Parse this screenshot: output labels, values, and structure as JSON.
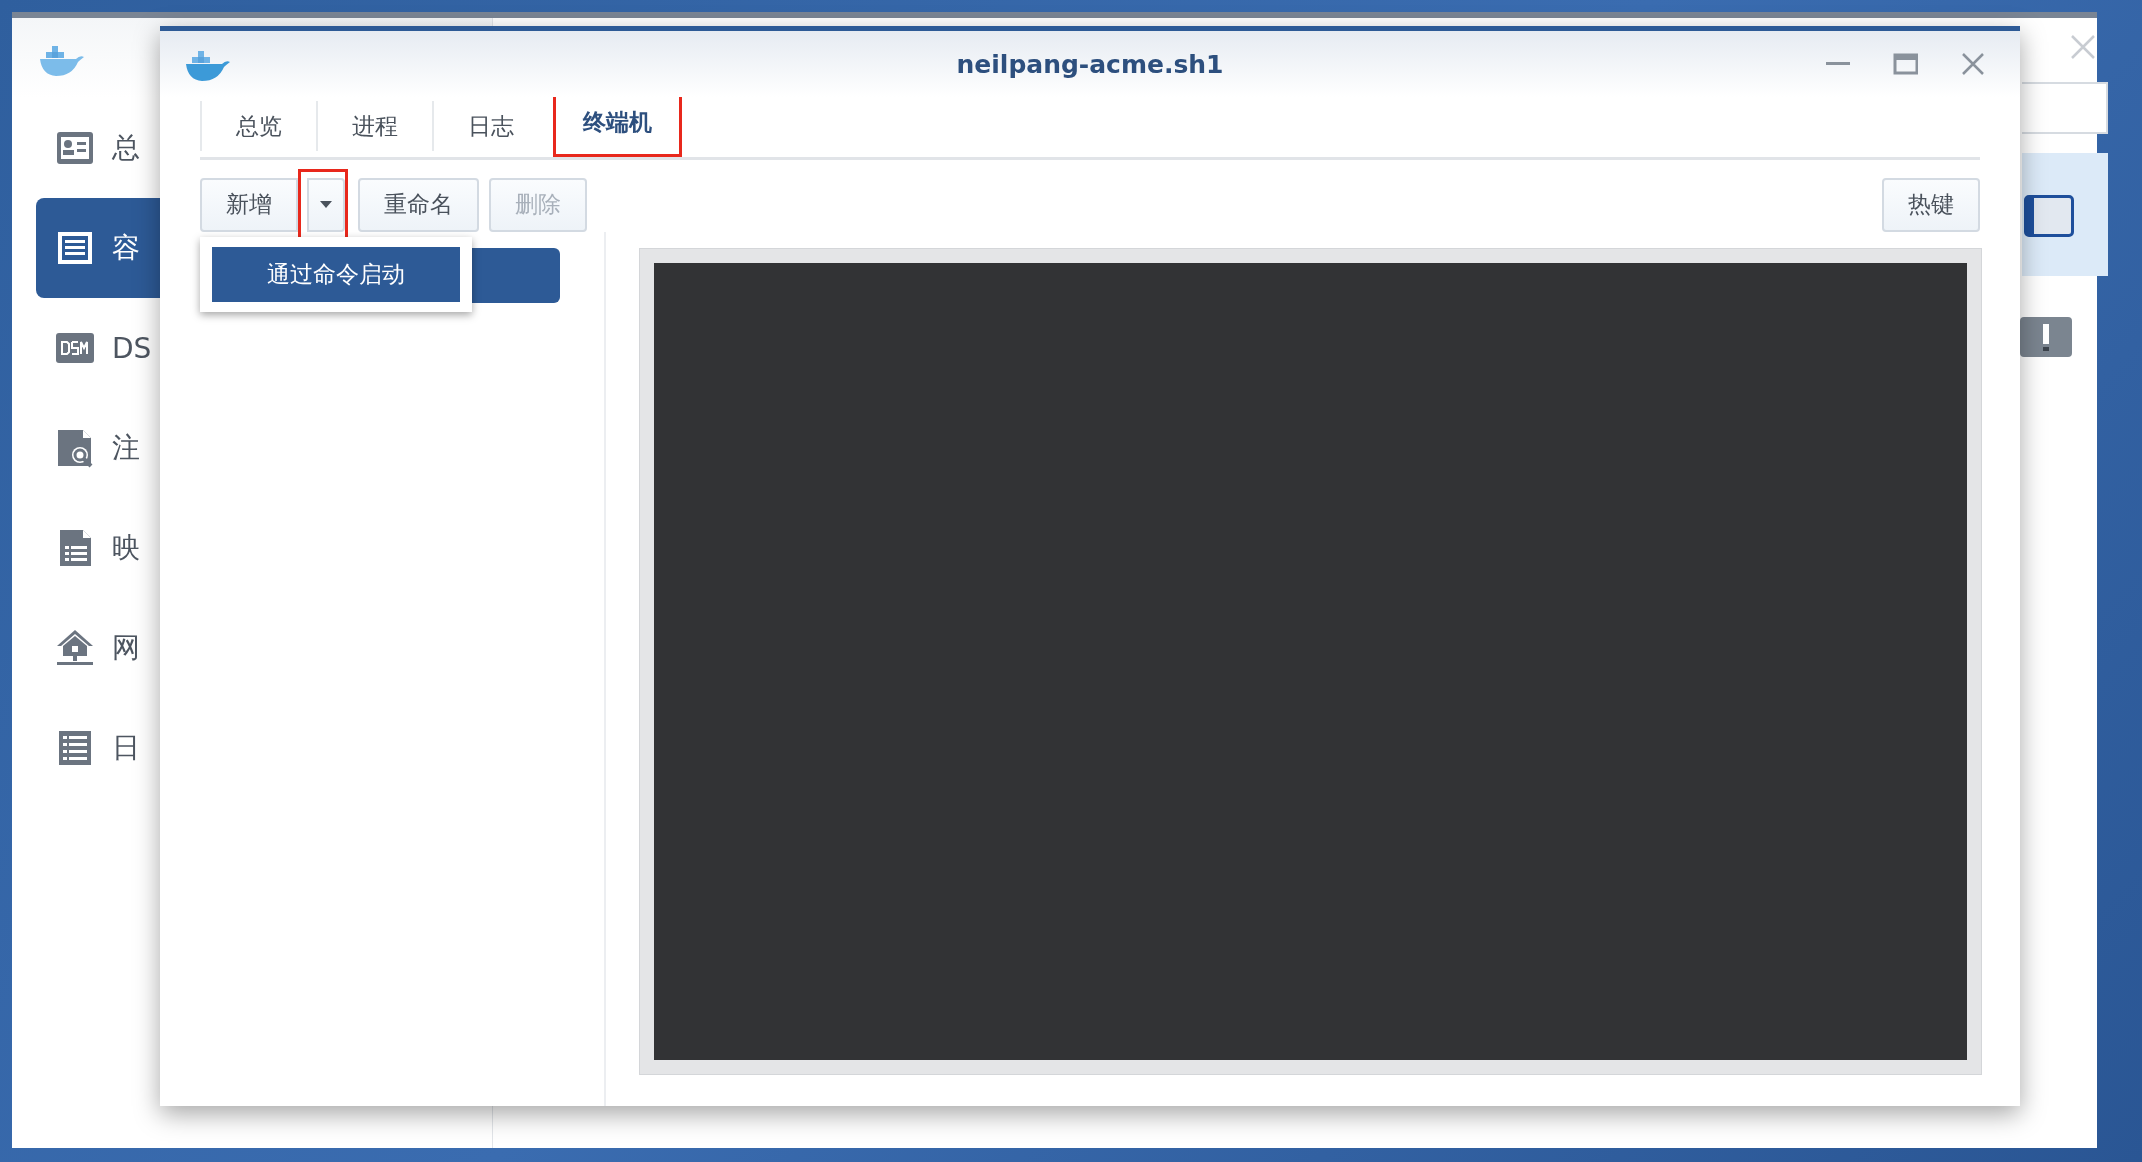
{
  "background_window": {
    "sidebar": {
      "items": [
        {
          "label": "总",
          "selected": false
        },
        {
          "label": "容",
          "selected": true
        },
        {
          "label": "DS",
          "selected": false
        },
        {
          "label": "注",
          "selected": false
        },
        {
          "label": "映",
          "selected": false
        },
        {
          "label": "网",
          "selected": false
        },
        {
          "label": "日",
          "selected": false
        }
      ]
    },
    "toggle": {
      "on": true
    }
  },
  "window": {
    "title": "neilpang-acme.sh1"
  },
  "tabs": [
    {
      "label": "总览",
      "selected": false,
      "annotated": false
    },
    {
      "label": "进程",
      "selected": false,
      "annotated": false
    },
    {
      "label": "日志",
      "selected": false,
      "annotated": false
    },
    {
      "label": "终端机",
      "selected": true,
      "annotated": true
    }
  ],
  "toolbar": {
    "buttons": [
      {
        "kind": "split",
        "label": "新增",
        "disabled": false,
        "arrow_annotated": true
      },
      {
        "kind": "plain",
        "label": "重命名",
        "disabled": false
      },
      {
        "kind": "plain",
        "label": "删除",
        "disabled": true
      }
    ],
    "hotkey_button": {
      "label": "热键"
    }
  },
  "dropdown_menu": {
    "items": [
      {
        "label": "通过命令启动",
        "selected": true
      }
    ]
  },
  "session_list": {
    "items": [
      {
        "selected": true
      }
    ]
  }
}
